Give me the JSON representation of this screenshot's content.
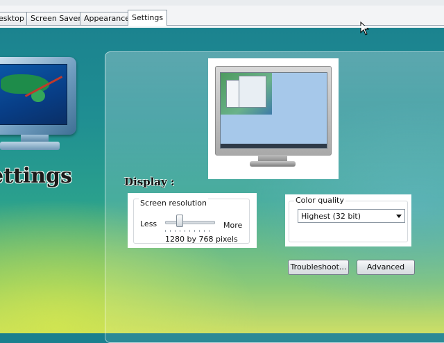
{
  "tabs": [
    {
      "label": "esktop"
    },
    {
      "label": "Screen Saver"
    },
    {
      "label": "Appearance"
    },
    {
      "label": "Settings",
      "active": true
    }
  ],
  "hero": {
    "title": "ettings",
    "icon": "monitor-paint-icon"
  },
  "preview": {
    "icon": "monitor-preview-icon"
  },
  "display": {
    "label": "Display :"
  },
  "resolution": {
    "legend": "Screen resolution",
    "less": "Less",
    "more": "More",
    "value_text": "1280 by 768 pixels",
    "slider_fraction": 0.3
  },
  "color_quality": {
    "legend": "Color quality",
    "selected": "Highest (32 bit)"
  },
  "buttons": {
    "troubleshoot": "Troubleshoot...",
    "advanced": "Advanced"
  },
  "cursor": {
    "icon": "mouse-pointer-icon"
  },
  "colors": {
    "background_top": "#1a7f8e",
    "background_bottom": "#c9dc5a",
    "panel_border": "#ffffff"
  }
}
